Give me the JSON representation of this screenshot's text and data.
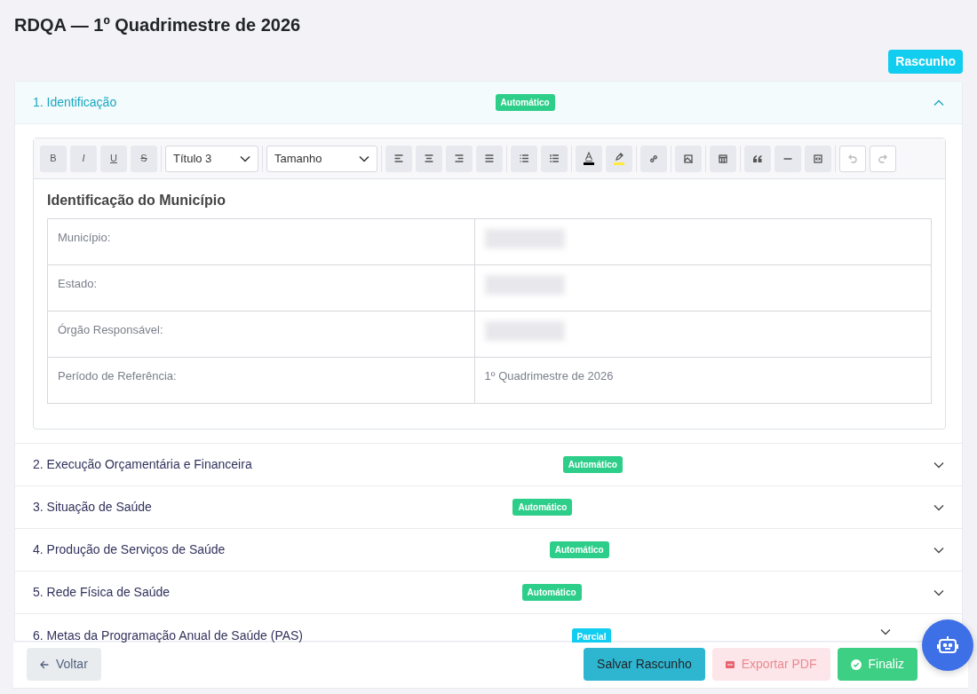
{
  "title": "RDQA — 1º Quadrimestre de 2026",
  "status_badge": "Rascunho",
  "sections": [
    {
      "title": "1. Identificação",
      "badge": {
        "text": "Automático",
        "color": "#2dce89"
      },
      "expanded": true
    },
    {
      "title": "2. Execução Orçamentária e Financeira",
      "badge": {
        "text": "Automático",
        "color": "#2dce89"
      },
      "expanded": false
    },
    {
      "title": "3. Situação de Saúde",
      "badge": {
        "text": "Automático",
        "color": "#2dce89"
      },
      "expanded": false
    },
    {
      "title": "4. Produção de Serviços de Saúde",
      "badge": {
        "text": "Automático",
        "color": "#2dce89"
      },
      "expanded": false
    },
    {
      "title": "5. Rede Física de Saúde",
      "badge": {
        "text": "Automático",
        "color": "#2dce89"
      },
      "expanded": false
    },
    {
      "title": "6. Metas da Programação Anual de Saúde (PAS)",
      "badge": {
        "text": "Parcial",
        "color": "#11cdef"
      },
      "expanded": false
    }
  ],
  "editor": {
    "toolbar": [
      [
        {
          "kind": "bold",
          "label": "B"
        },
        {
          "kind": "italic",
          "label": "I"
        },
        {
          "kind": "underline",
          "label": "U"
        },
        {
          "kind": "strike",
          "label": "S"
        }
      ],
      [
        {
          "kind": "select",
          "value": "Título 3"
        }
      ],
      [
        {
          "kind": "select",
          "value": "Tamanho"
        }
      ],
      [
        {
          "kind": "alignleft"
        },
        {
          "kind": "aligncenter"
        },
        {
          "kind": "alignright"
        },
        {
          "kind": "justify"
        }
      ],
      [
        {
          "kind": "bullets"
        },
        {
          "kind": "numbering"
        }
      ],
      [
        {
          "kind": "textcolor",
          "color": "#000000"
        },
        {
          "kind": "highlight",
          "color": "#ffeb3b"
        }
      ],
      [
        {
          "kind": "link"
        }
      ],
      [
        {
          "kind": "image"
        }
      ],
      [
        {
          "kind": "table"
        }
      ],
      [
        {
          "kind": "quote"
        },
        {
          "kind": "rule"
        },
        {
          "kind": "embed"
        }
      ],
      [
        {
          "kind": "undo",
          "disabled": true
        },
        {
          "kind": "redo",
          "disabled": true
        }
      ]
    ],
    "heading": "Identificação do Município",
    "rows": [
      {
        "label": "Município:",
        "redacted": true
      },
      {
        "label": "Estado:",
        "redacted": true
      },
      {
        "label": "Órgão Responsável:",
        "redacted": true
      },
      {
        "label": "Período de Referência:",
        "redacted": false,
        "value": "1º Quadrimestre de 2026"
      }
    ]
  },
  "footer": {
    "left": [
      {
        "kind": "back",
        "label": "Voltar"
      }
    ],
    "right": [
      {
        "kind": "save",
        "label": "Salvar Rascunho"
      },
      {
        "kind": "pdf",
        "label": "Exportar PDF"
      },
      {
        "kind": "finish",
        "label": "Finaliz"
      }
    ]
  }
}
